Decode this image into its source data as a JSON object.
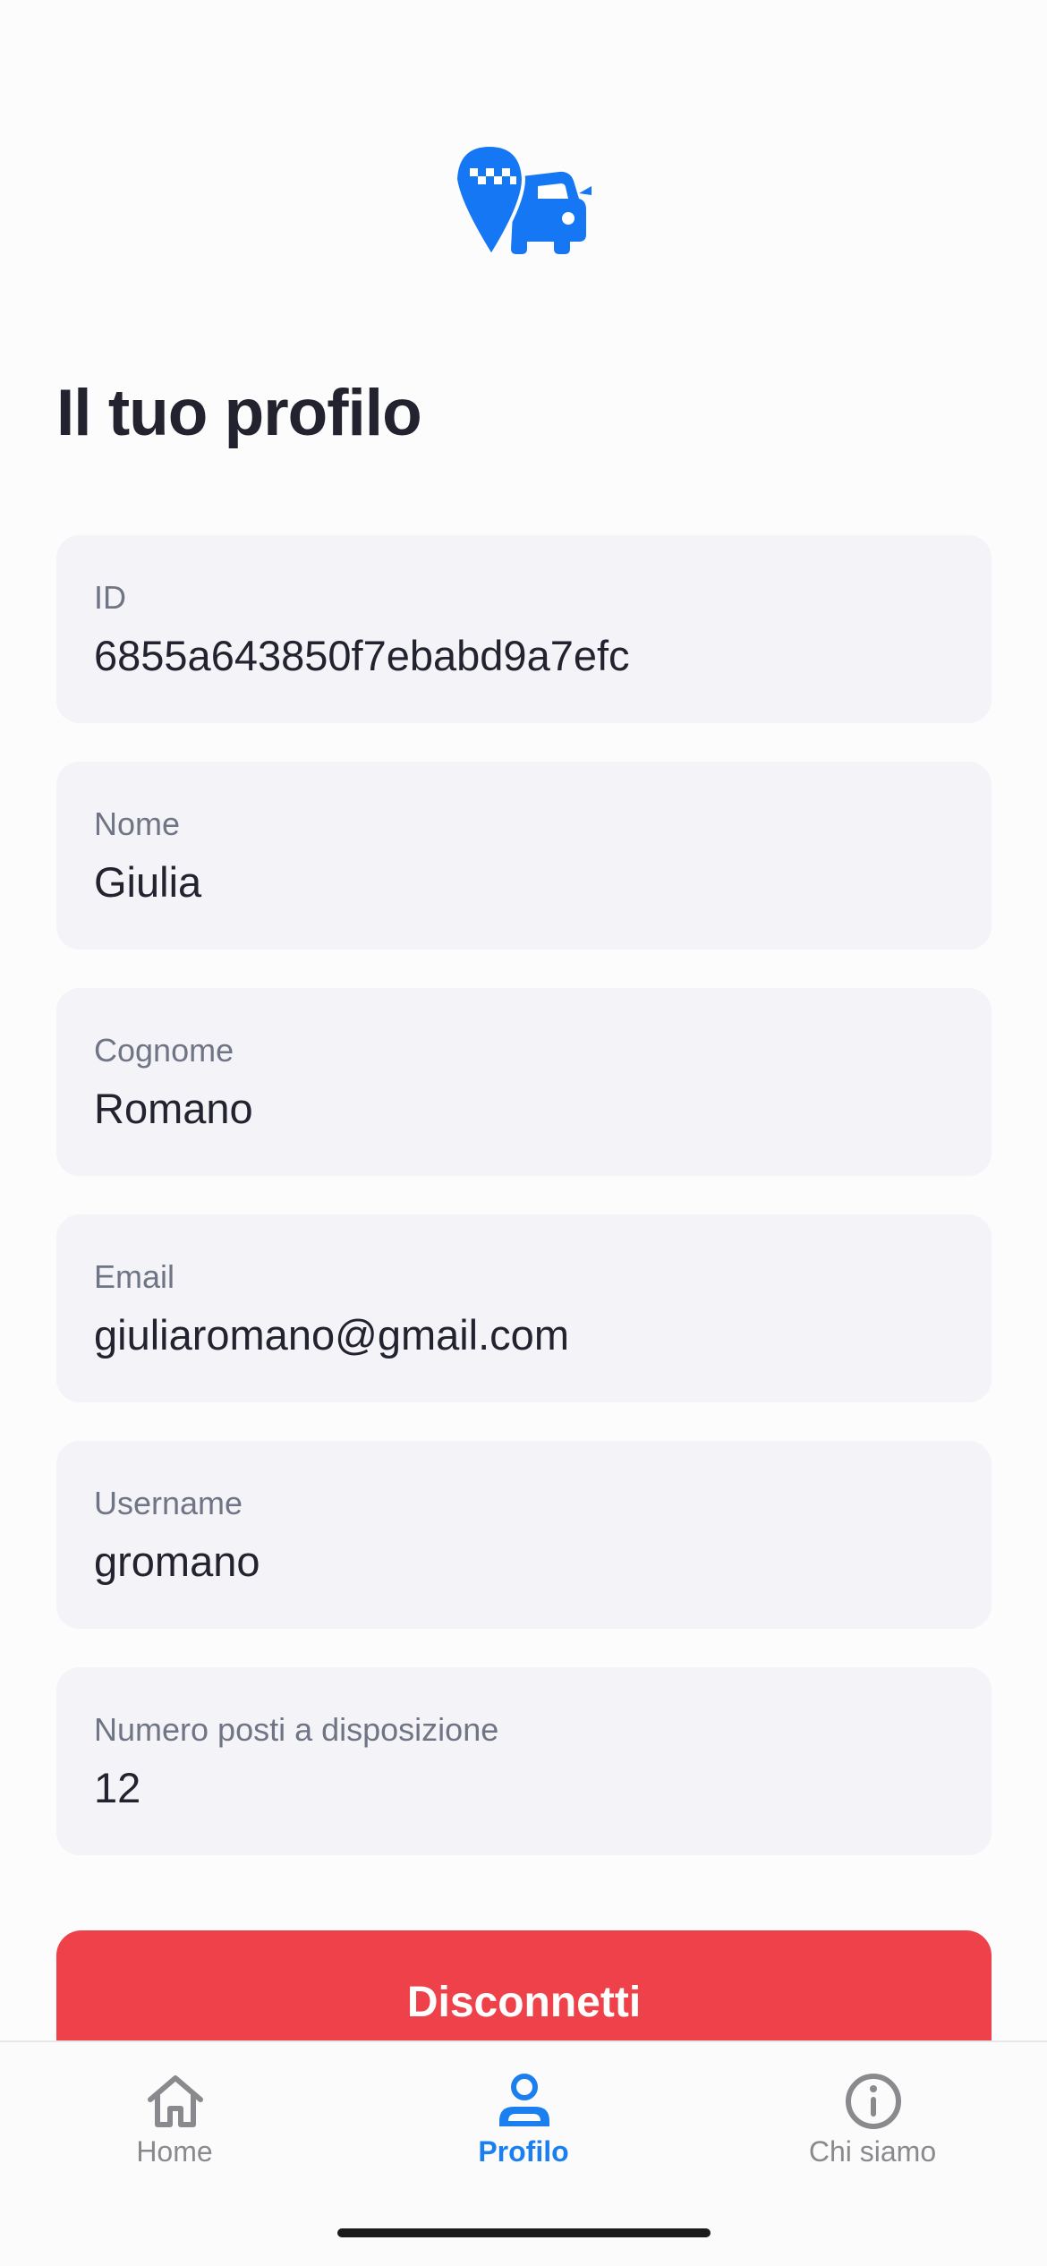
{
  "header": {
    "logo_icon": "taxi-location-car-icon",
    "brand_color": "#1677f5"
  },
  "page": {
    "title": "Il tuo profilo"
  },
  "profile": {
    "fields": [
      {
        "label": "ID",
        "value": "6855a643850f7ebabd9a7efc"
      },
      {
        "label": "Nome",
        "value": "Giulia"
      },
      {
        "label": "Cognome",
        "value": "Romano"
      },
      {
        "label": "Email",
        "value": "giuliaromano@gmail.com"
      },
      {
        "label": "Username",
        "value": "gromano"
      },
      {
        "label": "Numero posti a disposizione",
        "value": "12"
      }
    ]
  },
  "actions": {
    "logout_label": "Disconnetti",
    "logout_color": "#ef4149"
  },
  "tabbar": {
    "tabs": [
      {
        "label": "Home",
        "icon": "home-icon",
        "active": false
      },
      {
        "label": "Profilo",
        "icon": "person-icon",
        "active": true
      },
      {
        "label": "Chi siamo",
        "icon": "info-icon",
        "active": false
      }
    ],
    "active_color": "#1c7ff0",
    "inactive_color": "#8a8a8e"
  }
}
